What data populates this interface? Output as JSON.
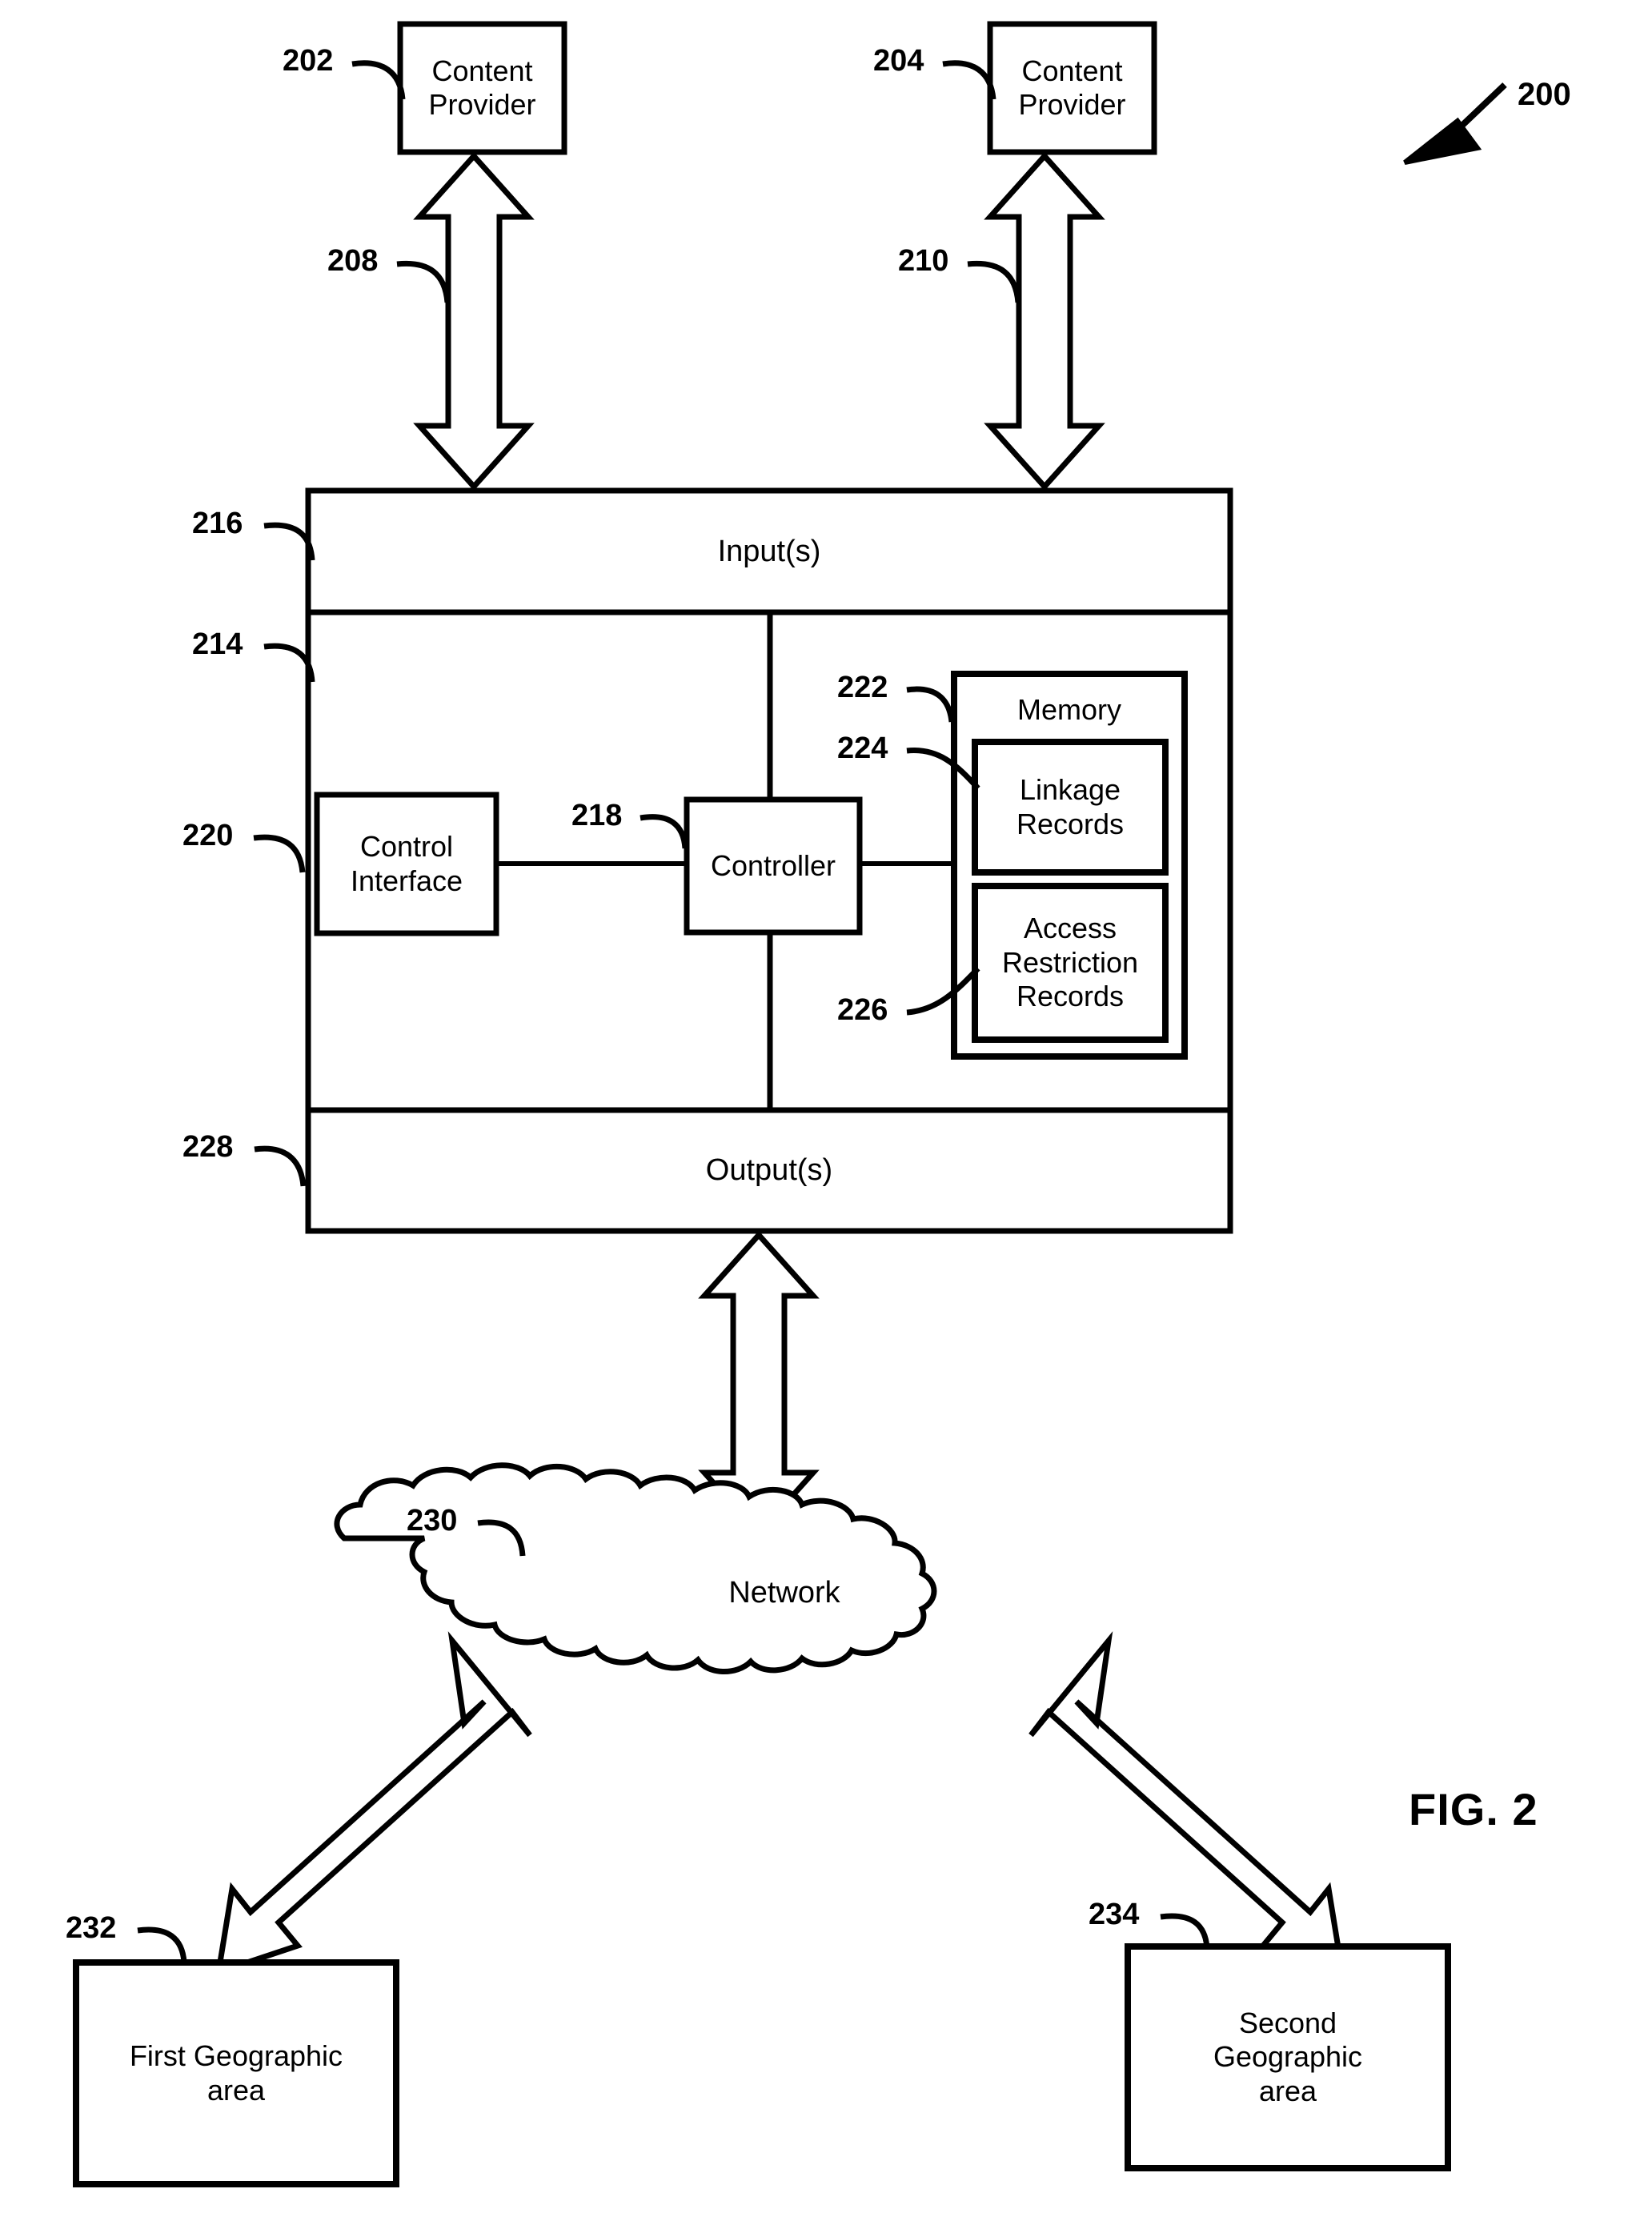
{
  "figure": {
    "title": "FIG. 2",
    "system_ref": "200"
  },
  "nodes": {
    "content_provider_1": {
      "label": "Content\nProvider",
      "ref": "202"
    },
    "content_provider_2": {
      "label": "Content\nProvider",
      "ref": "204"
    },
    "inputs": {
      "label": "Input(s)",
      "ref": "216"
    },
    "system": {
      "ref": "214"
    },
    "control_interface": {
      "label": "Control\nInterface",
      "ref": "220"
    },
    "controller": {
      "label": "Controller",
      "ref": "218"
    },
    "memory": {
      "label": "Memory",
      "ref": "222"
    },
    "linkage_records": {
      "label": "Linkage\nRecords",
      "ref": "224"
    },
    "access_restriction_records": {
      "label": "Access\nRestriction\nRecords",
      "ref": "226"
    },
    "outputs": {
      "label": "Output(s)",
      "ref": "228"
    },
    "network": {
      "label": "Network",
      "ref": "230"
    },
    "first_geographic_area": {
      "label": "First Geographic\narea",
      "ref": "232"
    },
    "second_geographic_area": {
      "label": "Second\nGeographic\narea",
      "ref": "234"
    }
  },
  "connections": {
    "cp1_to_inputs": {
      "ref": "208"
    },
    "cp2_to_inputs": {
      "ref": "210"
    }
  },
  "colors": {
    "line": "#000000",
    "fill": "#ffffff",
    "text": "#000000"
  }
}
